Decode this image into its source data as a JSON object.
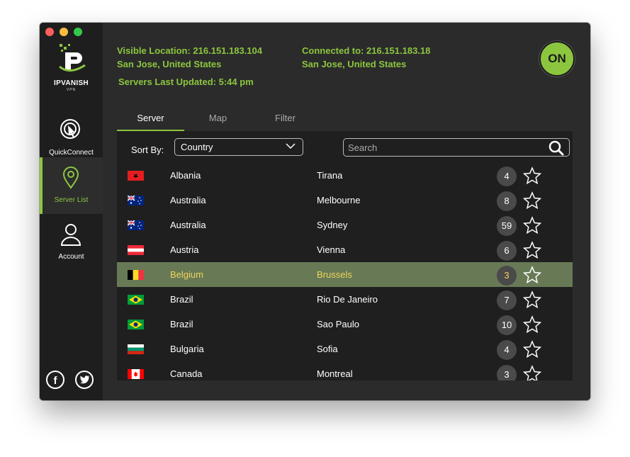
{
  "app": {
    "logo_text": "IPVANISH",
    "logo_sub": "VPN",
    "accent_color": "#8cc63f",
    "selected_row_color": "#677a55"
  },
  "sidebar": {
    "items": [
      {
        "label": "QuickConnect",
        "icon": "quickconnect-icon"
      },
      {
        "label": "Server List",
        "icon": "map-pin-icon"
      },
      {
        "label": "Account",
        "icon": "user-icon"
      }
    ],
    "social": {
      "facebook": "f",
      "twitter": "twitter-icon"
    }
  },
  "header": {
    "visible_label": "Visible Location:",
    "visible_ip": "216.151.183.104",
    "visible_location": "San Jose, United States",
    "connected_label": "Connected to:",
    "connected_ip": "216.151.183.18",
    "connected_location": "San Jose, United States",
    "updated_label": "Servers Last Updated:",
    "updated_time": "5:44 pm",
    "on_button": "ON"
  },
  "tabs": [
    {
      "label": "Server",
      "active": true
    },
    {
      "label": "Map",
      "active": false
    },
    {
      "label": "Filter",
      "active": false
    }
  ],
  "toolbar": {
    "sort_label": "Sort By:",
    "sort_value": "Country",
    "search_placeholder": "Search"
  },
  "servers": [
    {
      "country": "Albania",
      "city": "Tirana",
      "count": "4",
      "flag": "albania"
    },
    {
      "country": "Australia",
      "city": "Melbourne",
      "count": "8",
      "flag": "australia"
    },
    {
      "country": "Australia",
      "city": "Sydney",
      "count": "59",
      "flag": "australia"
    },
    {
      "country": "Austria",
      "city": "Vienna",
      "count": "6",
      "flag": "austria"
    },
    {
      "country": "Belgium",
      "city": "Brussels",
      "count": "3",
      "flag": "belgium",
      "selected": true
    },
    {
      "country": "Brazil",
      "city": "Rio De Janeiro",
      "count": "7",
      "flag": "brazil"
    },
    {
      "country": "Brazil",
      "city": "Sao Paulo",
      "count": "10",
      "flag": "brazil"
    },
    {
      "country": "Bulgaria",
      "city": "Sofia",
      "count": "4",
      "flag": "bulgaria"
    },
    {
      "country": "Canada",
      "city": "Montreal",
      "count": "3",
      "flag": "canada"
    }
  ]
}
